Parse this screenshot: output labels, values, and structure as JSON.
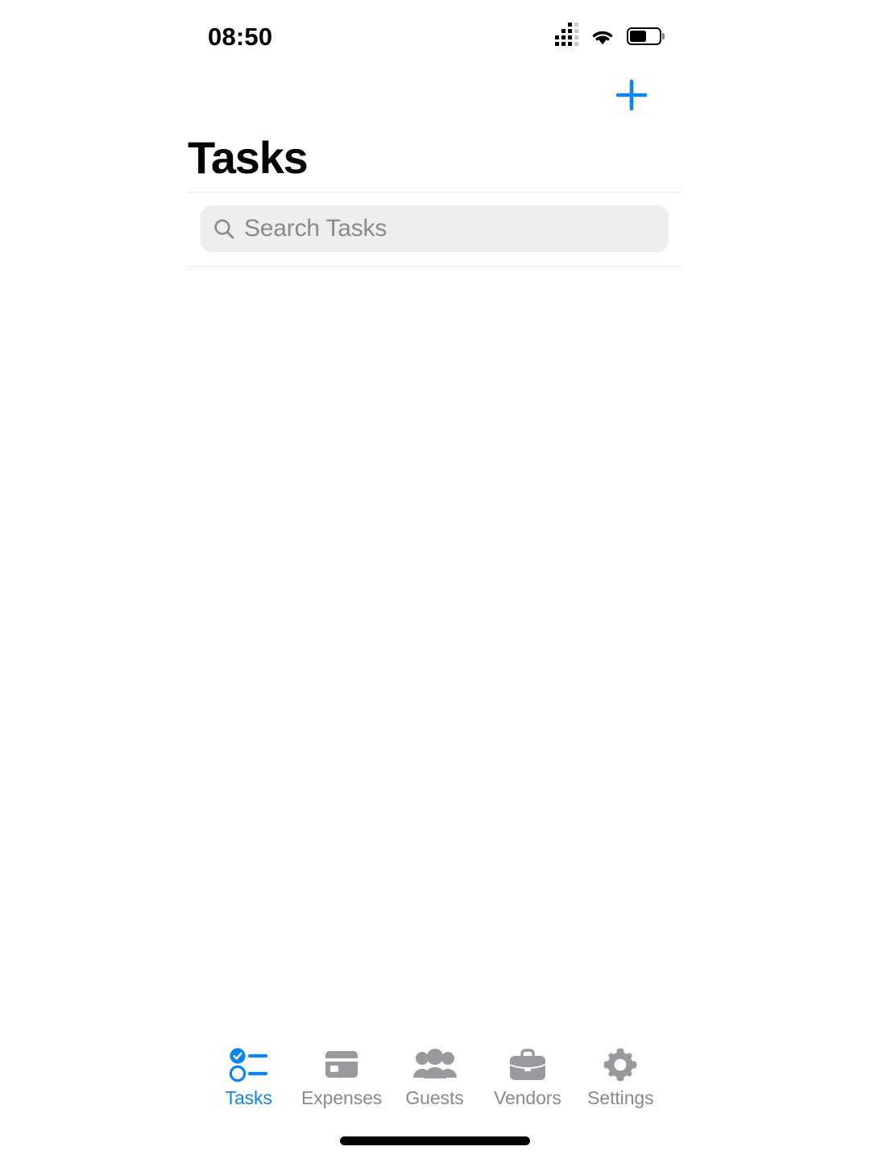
{
  "status_bar": {
    "time": "08:50",
    "cellular_icon": "cellular-dots-icon",
    "cellular_bars_total": 4,
    "cellular_bars_active": 3,
    "wifi_icon": "wifi-icon",
    "battery_icon": "battery-icon",
    "battery_level_percent": 58
  },
  "nav": {
    "title": "Tasks",
    "add_button_icon": "plus-icon",
    "add_button_label": "+",
    "accent_color": "#0a84f0"
  },
  "search": {
    "placeholder": "Search Tasks",
    "value": "",
    "icon": "search-icon",
    "background_color": "#eeeeef",
    "text_color": "#8a8a8e"
  },
  "content": {
    "items": [],
    "empty": true
  },
  "tab_bar": {
    "active_index": 0,
    "active_color": "#0a84f0",
    "inactive_color": "#8a8a8e",
    "items": [
      {
        "label": "Tasks",
        "icon": "checklist-icon"
      },
      {
        "label": "Expenses",
        "icon": "credit-card-icon"
      },
      {
        "label": "Guests",
        "icon": "people-group-icon"
      },
      {
        "label": "Vendors",
        "icon": "briefcase-icon"
      },
      {
        "label": "Settings",
        "icon": "gear-icon"
      }
    ]
  },
  "home_indicator": {
    "icon": "home-indicator"
  }
}
